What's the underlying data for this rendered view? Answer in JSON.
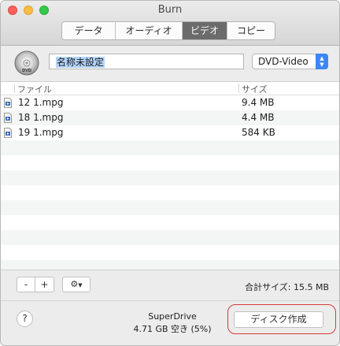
{
  "window": {
    "title": "Burn"
  },
  "tabs": [
    {
      "label": "データ",
      "active": false
    },
    {
      "label": "オーディオ",
      "active": false
    },
    {
      "label": "ビデオ",
      "active": true
    },
    {
      "label": "コピー",
      "active": false
    }
  ],
  "disc": {
    "icon": "dvd-disc-icon",
    "icon_label": "DVD",
    "name_value": "名称未設定",
    "format": "DVD-Video"
  },
  "table": {
    "columns": [
      "ファイル",
      "サイズ"
    ],
    "rows": [
      {
        "name": "12 1.mpg",
        "size": "9.4 MB",
        "icon": "video-file-icon"
      },
      {
        "name": "18 1.mpg",
        "size": "4.4 MB",
        "icon": "video-file-icon"
      },
      {
        "name": "19 1.mpg",
        "size": "584 KB",
        "icon": "video-file-icon"
      }
    ]
  },
  "controls": {
    "remove_label": "-",
    "add_label": "+",
    "gear_icon": "gear-icon",
    "total_size": "合計サイズ: 15.5 MB"
  },
  "footer": {
    "help_label": "?",
    "drive_name": "SuperDrive",
    "drive_free": "4.71 GB 空き (5%)",
    "burn_label": "ディスク作成"
  },
  "colors": {
    "active_tab": "#6b6b6b",
    "select_accent": "#3a87f5",
    "highlight": "#d93a3a",
    "close": "#fc605b",
    "minimize": "#fdbc40",
    "zoom": "#34c84a"
  }
}
